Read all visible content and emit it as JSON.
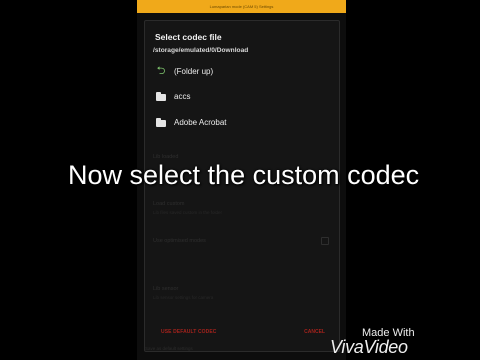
{
  "app_bar": {
    "text": "Lumaparian mode (CAM 5) Settings"
  },
  "background": {
    "items": [
      {
        "label": "Lib loaded"
      },
      {
        "label": "Load custom"
      },
      {
        "label": "Lib files saved custom in the folder"
      },
      {
        "label": "Use optimised modes"
      },
      {
        "label": "Lib sensor"
      },
      {
        "label": "Lib sensor settings for camera"
      }
    ],
    "bottom_text": "Save as default settings"
  },
  "dialog": {
    "title": "Select codec file",
    "path": "/storage/emulated/0/Download",
    "items": [
      {
        "label": "(Folder up)",
        "icon": "folder-up-arrow-icon"
      },
      {
        "label": "accs",
        "icon": "folder-icon"
      },
      {
        "label": "Adobe Acrobat",
        "icon": "folder-icon"
      }
    ],
    "buttons": {
      "default": "USE DEFAULT CODEC",
      "cancel": "CANCEL"
    }
  },
  "caption": "Now select the custom codec",
  "watermark": {
    "made_with": "Made With",
    "brand": "VivaVideo"
  },
  "colors": {
    "app_bar": "#f0a91a",
    "dialog_bg": "#151515",
    "button_text": "#a3221c",
    "folder_up_arrow": "#7ec46d"
  }
}
